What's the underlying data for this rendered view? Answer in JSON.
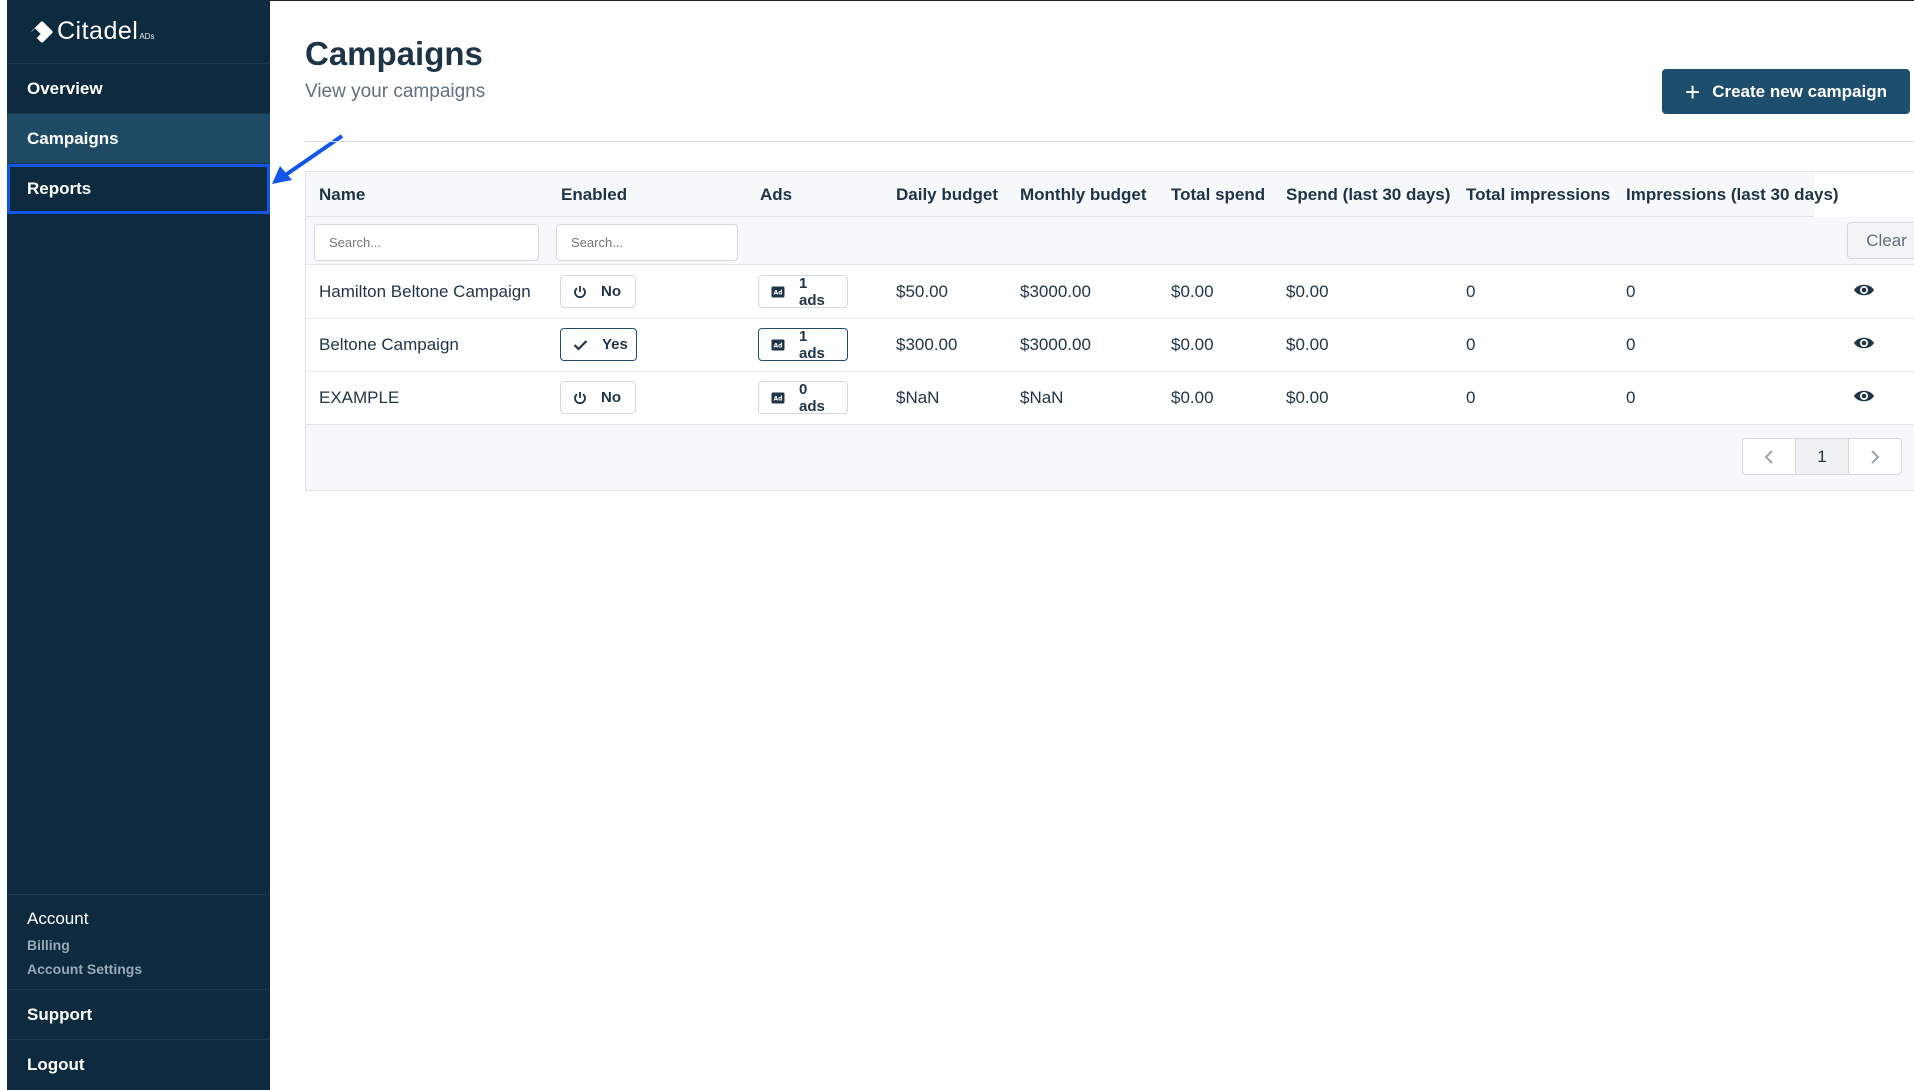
{
  "app": {
    "logo_text": "Citadel",
    "logo_sub": "ADs"
  },
  "sidebar": {
    "items": [
      {
        "label": "Overview"
      },
      {
        "label": "Campaigns"
      },
      {
        "label": "Reports"
      }
    ],
    "account": {
      "title": "Account",
      "billing": "Billing",
      "settings": "Account Settings"
    },
    "support": "Support",
    "logout": "Logout"
  },
  "header": {
    "title": "Campaigns",
    "subtitle": "View your campaigns",
    "create_label": "Create new campaign"
  },
  "table": {
    "columns": [
      "Name",
      "Enabled",
      "Ads",
      "Daily budget",
      "Monthly budget",
      "Total spend",
      "Spend (last 30 days)",
      "Total impressions",
      "Impressions (last 30 days)"
    ],
    "search_placeholder": "Search...",
    "clear_label": "Clear",
    "rows": [
      {
        "name": "Hamilton Beltone Campaign",
        "enabled": "No",
        "ads": "1 ads",
        "daily": "$50.00",
        "monthly": "$3000.00",
        "total_spend": "$0.00",
        "spend30": "$0.00",
        "impressions": "0",
        "impressions30": "0"
      },
      {
        "name": "Beltone Campaign",
        "enabled": "Yes",
        "ads": "1 ads",
        "daily": "$300.00",
        "monthly": "$3000.00",
        "total_spend": "$0.00",
        "spend30": "$0.00",
        "impressions": "0",
        "impressions30": "0"
      },
      {
        "name": "EXAMPLE",
        "enabled": "No",
        "ads": "0 ads",
        "daily": "$NaN",
        "monthly": "$NaN",
        "total_spend": "$0.00",
        "spend30": "$0.00",
        "impressions": "0",
        "impressions30": "0"
      }
    ],
    "page": "1"
  },
  "colors": {
    "sidebar_bg": "#0e2a3e",
    "active_item": "#1e4a66",
    "primary_button": "#1d4e6e",
    "highlight": "#1156e8"
  }
}
